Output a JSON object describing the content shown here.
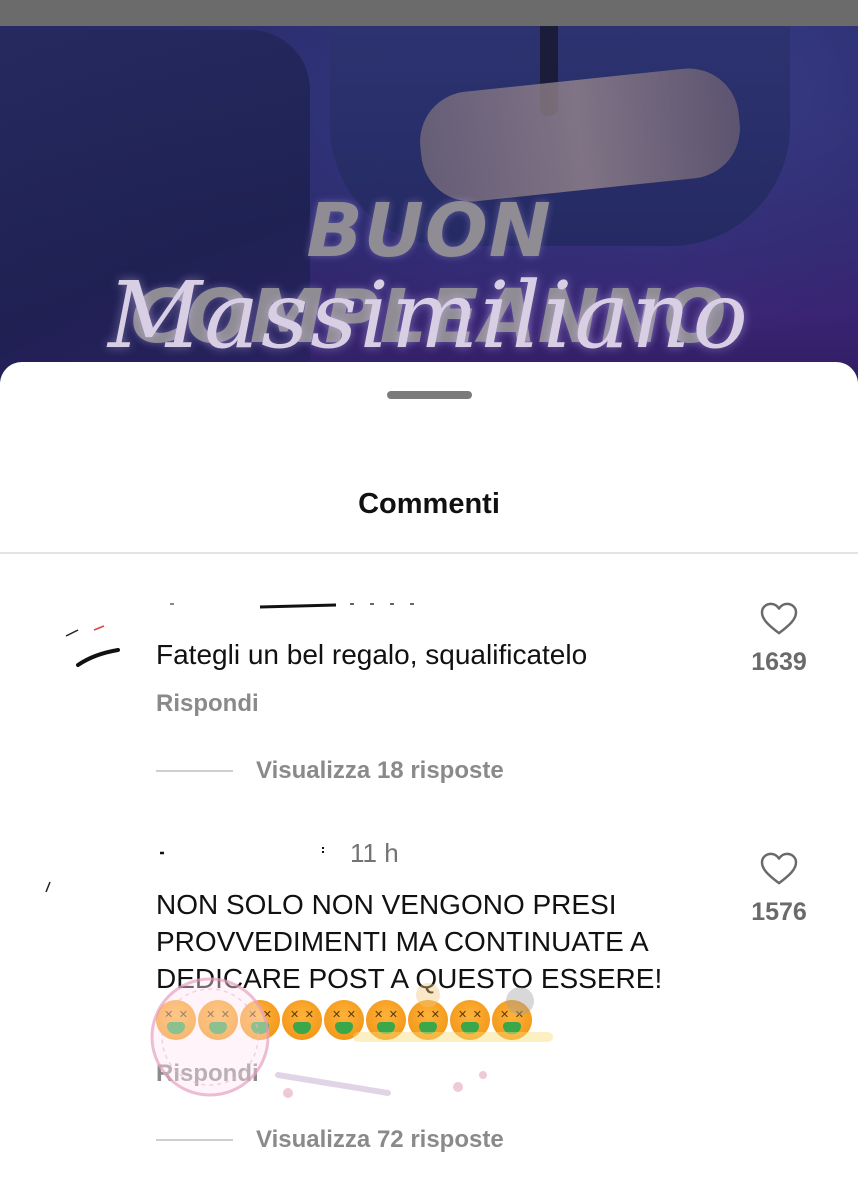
{
  "post": {
    "headline": "BUON COMPLEANNO",
    "script_line": "Massimiliano"
  },
  "sheet": {
    "title": "Commenti"
  },
  "comments": [
    {
      "time": "",
      "text": "Fategli un bel regalo, squalificatelo",
      "reply_label": "Rispondi",
      "view_replies_label": "Visualizza 18 risposte",
      "likes": "1639",
      "like_icon": "heart-outline-icon"
    },
    {
      "time": "11 h",
      "text": "NON SOLO NON VENGONO PRESI PROVVEDIMENTI MA CONTINUATE A DEDICARE POST A QUESTO ESSERE!",
      "emoji_count": 9,
      "emoji_name": "nauseated-face-icon",
      "reply_label": "Rispondi",
      "view_replies_label": "Visualizza 72 risposte",
      "likes": "1576",
      "like_icon": "heart-outline-icon"
    }
  ],
  "colors": {
    "post_background": "#2c2468",
    "sheet_background": "#ffffff",
    "secondary_text": "#8a8a8a",
    "primary_text": "#111111"
  }
}
